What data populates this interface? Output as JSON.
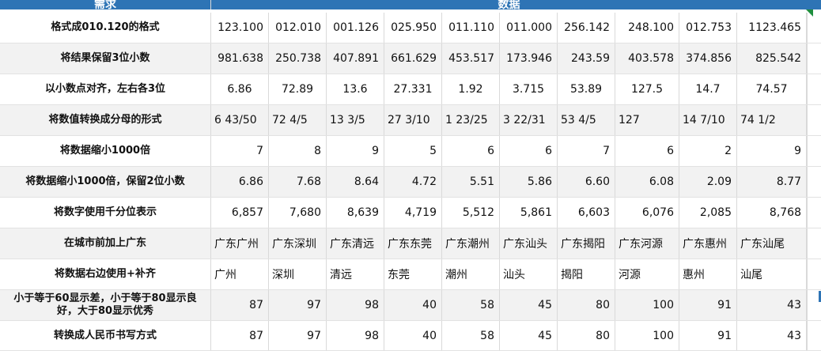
{
  "header": {
    "requirement": "需求",
    "data": "数据"
  },
  "rows": [
    {
      "label": "格式成010.120的格式",
      "values": [
        "123.100",
        "012.010",
        "001.126",
        "025.950",
        "011.110",
        "011.000",
        "256.142",
        "248.100",
        "012.753",
        "1123.465"
      ]
    },
    {
      "label": "将结果保留3位小数",
      "values": [
        "981.638",
        "250.738",
        "407.891",
        "661.629",
        "453.517",
        "173.946",
        "243.59",
        "403.578",
        "374.856",
        "825.542"
      ]
    },
    {
      "label": "以小数点对齐，左右各3位",
      "values": [
        "6.86",
        "72.89",
        "13.6",
        "27.331",
        "1.92",
        "3.715",
        "53.89",
        "127.5",
        "14.7",
        "74.57"
      ]
    },
    {
      "label": "将数值转换成分母的形式",
      "values": [
        "6 43/50",
        "72  4/5",
        "13  3/5",
        "27  3/10",
        "1 23/25",
        "3 22/31",
        "53  4/5",
        "127",
        "14  7/10",
        "74  1/2"
      ]
    },
    {
      "label": "将数据缩小1000倍",
      "values": [
        "7",
        "8",
        "9",
        "5",
        "6",
        "6",
        "7",
        "6",
        "2",
        "9"
      ]
    },
    {
      "label": "将数据缩小1000倍，保留2位小数",
      "values": [
        "6.86",
        "7.68",
        "8.64",
        "4.72",
        "5.51",
        "5.86",
        "6.60",
        "6.08",
        "2.09",
        "8.77"
      ]
    },
    {
      "label": "将数字使用千分位表示",
      "values": [
        "6,857",
        "7,680",
        "8,639",
        "4,719",
        "5,512",
        "5,861",
        "6,603",
        "6,076",
        "2,085",
        "8,768"
      ]
    },
    {
      "label": "在城市前加上广东",
      "values": [
        "广东广州",
        "广东深圳",
        "广东清远",
        "广东东莞",
        "广东潮州",
        "广东汕头",
        "广东揭阳",
        "广东河源",
        "广东惠州",
        "广东汕尾"
      ]
    },
    {
      "label": "将数据右边使用+补齐",
      "values": [
        "广州",
        "深圳",
        "清远",
        "东莞",
        "潮州",
        "汕头",
        "揭阳",
        "河源",
        "惠州",
        "汕尾"
      ]
    },
    {
      "label": "小于等于60显示差，小于等于80显示良好，大于80显示优秀",
      "values": [
        "87",
        "97",
        "98",
        "40",
        "58",
        "45",
        "80",
        "100",
        "91",
        "43"
      ]
    },
    {
      "label": "转换成人民币书写方式",
      "values": [
        "87",
        "97",
        "98",
        "40",
        "58",
        "45",
        "80",
        "100",
        "91",
        "43"
      ]
    }
  ]
}
